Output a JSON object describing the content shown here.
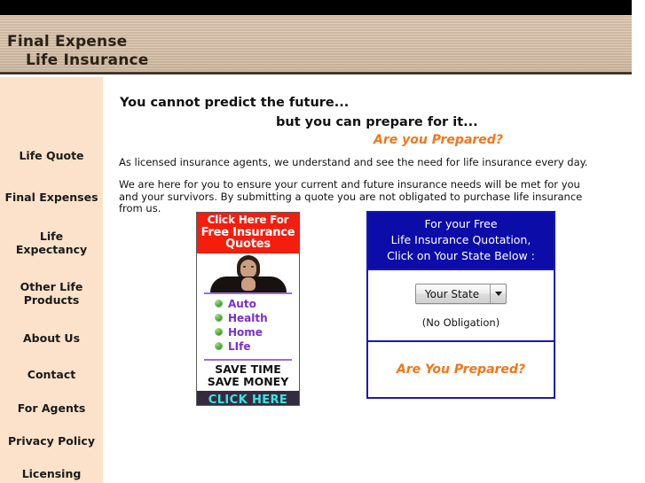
{
  "header": {
    "title_line1": "Final Expense",
    "title_line2": "Life Insurance"
  },
  "sidebar": {
    "items": [
      {
        "label": "Life Quote"
      },
      {
        "label": "Final Expenses"
      },
      {
        "label": "Life\nExpectancy"
      },
      {
        "label": "Other Life\nProducts"
      },
      {
        "label": "About Us"
      },
      {
        "label": "Contact"
      },
      {
        "label": "For Agents"
      },
      {
        "label": "Privacy Policy"
      },
      {
        "label": "Licensing"
      }
    ]
  },
  "main": {
    "tagline_line1": "You cannot predict the future...",
    "tagline_line2": "but you can prepare for it...",
    "tagline_line3": "Are you Prepared?",
    "paragraph1": "As licensed insurance agents, we understand and see the need for life insurance every day.",
    "paragraph2": "We are here for you to ensure your current and future insurance needs will be met for you and your survivors.  By submitting a quote you are not obligated to purchase life insurance from us."
  },
  "ad": {
    "head_line1": "Click Here For",
    "head_line2": "Free Insurance",
    "head_line3": "Quotes",
    "items": [
      {
        "label": "Auto"
      },
      {
        "label": "Health"
      },
      {
        "label": "Home"
      },
      {
        "label": "LIfe"
      }
    ],
    "save_line1": "SAVE TIME",
    "save_line2": "SAVE MONEY",
    "cta": "CLICK HERE",
    "colors": {
      "head_bg": "#f41d0e",
      "bullet": "#3f9b2d",
      "item_text": "#7a2fcf",
      "cta_bg": "#342c3e",
      "cta_text": "#37e6e6"
    }
  },
  "quote_box": {
    "head_line1": "For your Free",
    "head_line2": "Life Insurance Quotation,",
    "head_line3": "Click on Your State Below :",
    "state_select_value": "Your State",
    "no_obligation": "(No Obligation)",
    "prepared": "Are You Prepared?",
    "colors": {
      "border": "#1a18b8",
      "head_bg": "#0c0ca8",
      "accent": "#f3751a"
    }
  }
}
